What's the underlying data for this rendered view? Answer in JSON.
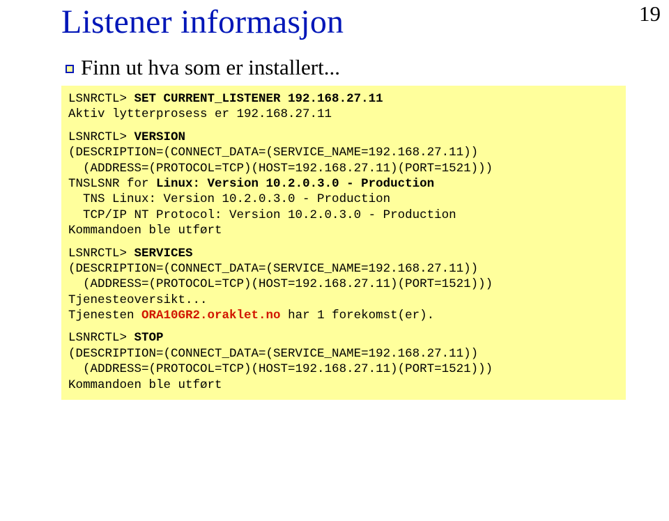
{
  "pagenum": "19",
  "title": "Listener informasjon",
  "bullet": "Finn ut hva som er installert...",
  "code": {
    "l1a": "LSNRCTL> ",
    "l1b": "SET CURRENT_LISTENER 192.168.27.11",
    "l2": "Aktiv lytterprosess er 192.168.27.11",
    "l3a": "LSNRCTL> ",
    "l3b": "VERSION",
    "l4": "(DESCRIPTION=(CONNECT_DATA=(SERVICE_NAME=192.168.27.11))",
    "l5": "  (ADDRESS=(PROTOCOL=TCP)(HOST=192.168.27.11)(PORT=1521)))",
    "l6a": "TNSLSNR for ",
    "l6b": "Linux: Version 10.2.0.3.0 - Production",
    "l7": "  TNS Linux: Version 10.2.0.3.0 - Production",
    "l8": "  TCP/IP NT Protocol: Version 10.2.0.3.0 - Production",
    "l9": "Kommandoen ble utført",
    "l10a": "LSNRCTL> ",
    "l10b": "SERVICES",
    "l11": "(DESCRIPTION=(CONNECT_DATA=(SERVICE_NAME=192.168.27.11))",
    "l12": "  (ADDRESS=(PROTOCOL=TCP)(HOST=192.168.27.11)(PORT=1521)))",
    "l13": "Tjenesteoversikt...",
    "l14a": "Tjenesten ",
    "l14b": "ORA10GR2.oraklet.no",
    "l14c": " har 1 forekomst(er).",
    "l15a": "LSNRCTL> ",
    "l15b": "STOP",
    "l16": "(DESCRIPTION=(CONNECT_DATA=(SERVICE_NAME=192.168.27.11))",
    "l17": "  (ADDRESS=(PROTOCOL=TCP)(HOST=192.168.27.11)(PORT=1521)))",
    "l18": "Kommandoen ble utført"
  }
}
